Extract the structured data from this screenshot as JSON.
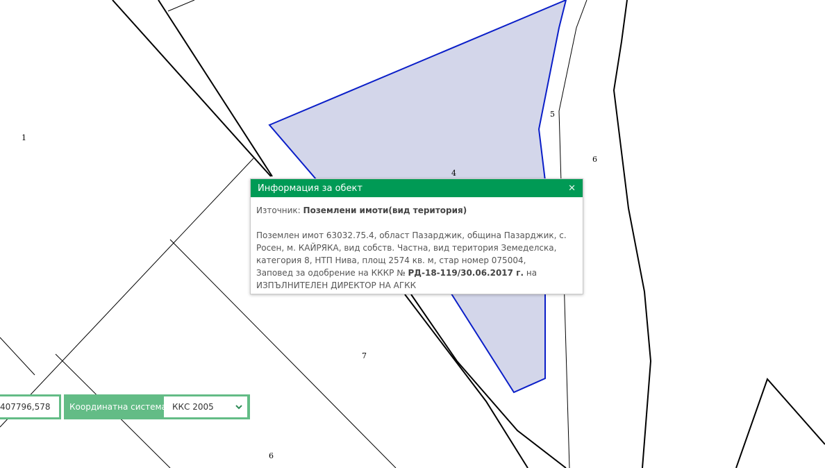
{
  "map": {
    "parcel_labels": [
      "1",
      "4",
      "5",
      "6",
      "7",
      "6"
    ]
  },
  "popup": {
    "title": "Информация за обект",
    "close_icon": "close-icon",
    "source_label": "Източник:",
    "source_value": "Поземлени имоти(вид територия)",
    "desc_line1": "Поземлен имот 63032.75.4, област Пазарджик, община Пазарджик, с.",
    "desc_line2": "Росен, м. КАЙРЯКА, вид собств. Частна, вид територия Земеделска,",
    "desc_line3": "категория 8, НТП Нива, площ 2574 кв. м, стар номер 075004,",
    "desc_line4_prefix": "Заповед за одобрение на КККР №",
    "desc_line4_order": "РД-18-119/30.06.2017 г.",
    "desc_line4_suffix": "на",
    "desc_line5": "ИЗПЪЛНИТЕЛЕН ДИРЕКТОР НА АГКК"
  },
  "coordinates": {
    "value": "407796,578",
    "system_label": "Координатна система",
    "system_selected": "ККС 2005",
    "dropdown_icon": "chevron-down-icon"
  },
  "colors": {
    "header_green": "#009a55",
    "coord_green": "#63bc86",
    "parcel_fill": "#d3d6ea",
    "parcel_stroke": "#0a1ec8"
  }
}
